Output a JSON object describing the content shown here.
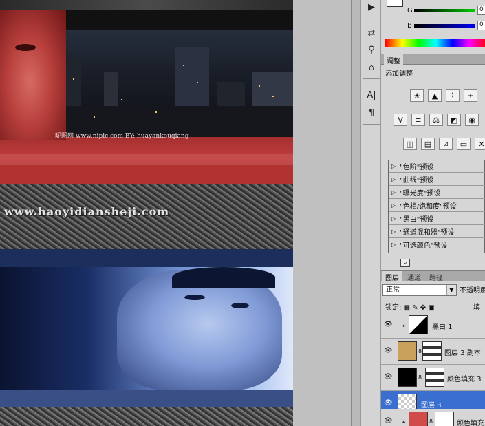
{
  "canvas": {
    "watermark_small": "昵图网 www.nipic.com  BY: huayankouqiang",
    "site_text": "www.haoyidiansheji.com"
  },
  "color_panel": {
    "g_label": "G",
    "b_label": "B",
    "g_value": "0",
    "b_value": "0"
  },
  "adjustments": {
    "tab_label": "调整",
    "title": "添加调整",
    "presets": [
      "\"色阶\"预设",
      "\"曲线\"预设",
      "\"曝光度\"预设",
      "\"色相/饱和度\"预设",
      "\"黑白\"预设",
      "\"通道混和器\"预设",
      "\"可选颜色\"预设"
    ]
  },
  "layers_panel": {
    "tabs": [
      "图层",
      "通道",
      "路径"
    ],
    "blend_mode": "正常",
    "opacity_label": "不透明度",
    "lock_label": "锁定:",
    "fill_label": "填充",
    "layers": [
      {
        "name": "黑白 1",
        "type": "adjustment"
      },
      {
        "name": "图层 3 副本",
        "type": "masked"
      },
      {
        "name": "颜色填充 3",
        "type": "fill"
      },
      {
        "name": "图层 3",
        "type": "pixel",
        "selected": true
      },
      {
        "name": "颜色填充",
        "type": "fill"
      }
    ]
  },
  "toolstrip": {
    "icons": [
      "play-icon",
      "sliders-icon",
      "brush-tool-icon",
      "stamp-icon",
      "character-icon",
      "paragraph-icon"
    ],
    "glyphs": [
      "▶",
      "⇄",
      "⚲",
      "⌂",
      "A|",
      "¶"
    ]
  }
}
